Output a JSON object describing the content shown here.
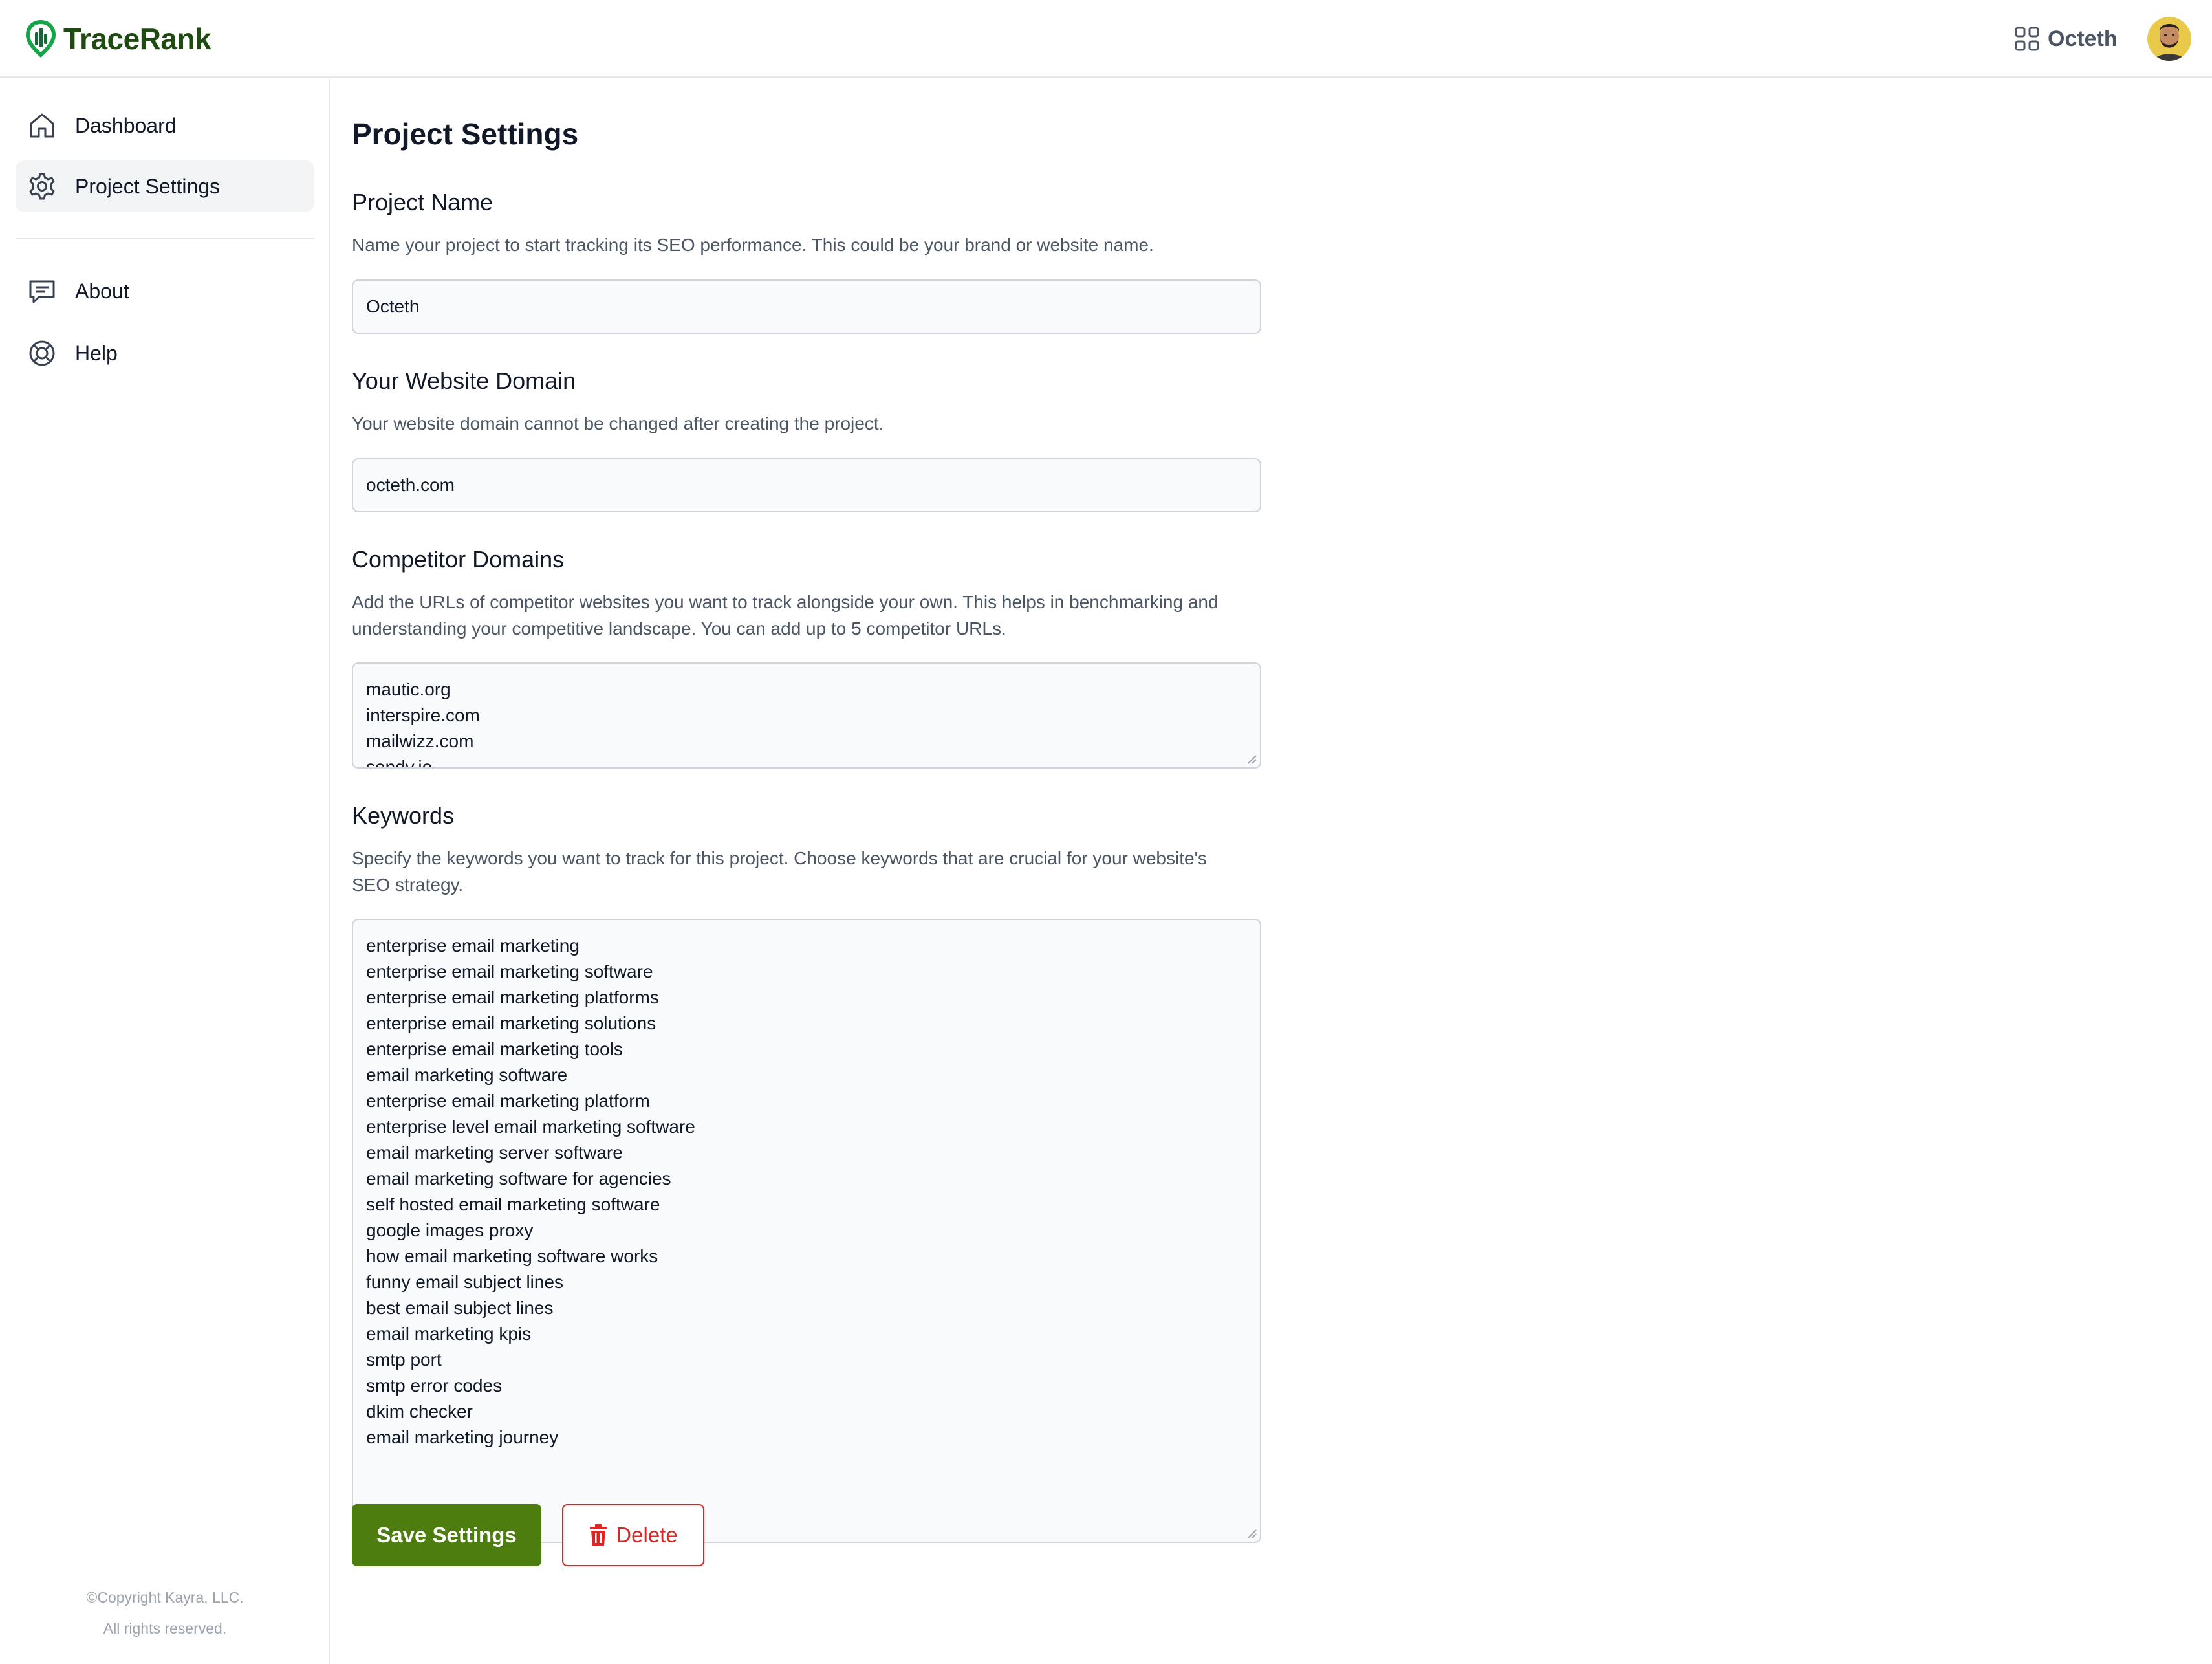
{
  "app": {
    "name": "TraceRank"
  },
  "header": {
    "project_name": "Octeth"
  },
  "sidebar": {
    "items": [
      {
        "label": "Dashboard",
        "icon": "home-icon"
      },
      {
        "label": "Project Settings",
        "icon": "gear-icon",
        "active": true
      },
      {
        "label": "About",
        "icon": "chat-bubble-icon"
      },
      {
        "label": "Help",
        "icon": "lifebuoy-icon"
      }
    ],
    "footer": {
      "line1": "©Copyright Kayra, LLC.",
      "line2": "All rights reserved."
    }
  },
  "page": {
    "title": "Project Settings"
  },
  "project_name": {
    "title": "Project Name",
    "description": "Name your project to start tracking its SEO performance. This could be your brand or website name.",
    "value": "Octeth"
  },
  "domain": {
    "title": "Your Website Domain",
    "description": "Your website domain cannot be changed after creating the project.",
    "value": "octeth.com"
  },
  "competitors": {
    "title": "Competitor Domains",
    "description_line1": "Add the URLs of competitor websites you want to track alongside your own. This helps in benchmarking and",
    "description_line2": "understanding your competitive landscape. You can add up to 5 competitor URLs.",
    "values": [
      "mautic.org",
      "interspire.com",
      "mailwizz.com",
      "sendy.io"
    ]
  },
  "keywords": {
    "title": "Keywords",
    "description_line1": "Specify the keywords you want to track for this project. Choose keywords that are crucial for your website's",
    "description_line2": "SEO strategy.",
    "values": [
      "enterprise email marketing",
      "enterprise email marketing software",
      "enterprise email marketing platforms",
      "enterprise email marketing solutions",
      "enterprise email marketing tools",
      "email marketing software",
      "enterprise email marketing platform",
      "enterprise level email marketing software",
      "email marketing server software",
      "email marketing software for agencies",
      "self hosted email marketing software",
      "google images proxy",
      "how email marketing software works",
      "funny email subject lines",
      "best email subject lines",
      "email marketing kpis",
      "smtp port",
      "smtp error codes",
      "dkim checker",
      "email marketing journey"
    ]
  },
  "actions": {
    "save_label": "Save Settings",
    "delete_label": "Delete"
  },
  "colors": {
    "brand": "#1f4a12",
    "primary": "#4d7c0f",
    "danger": "#dc2626"
  }
}
